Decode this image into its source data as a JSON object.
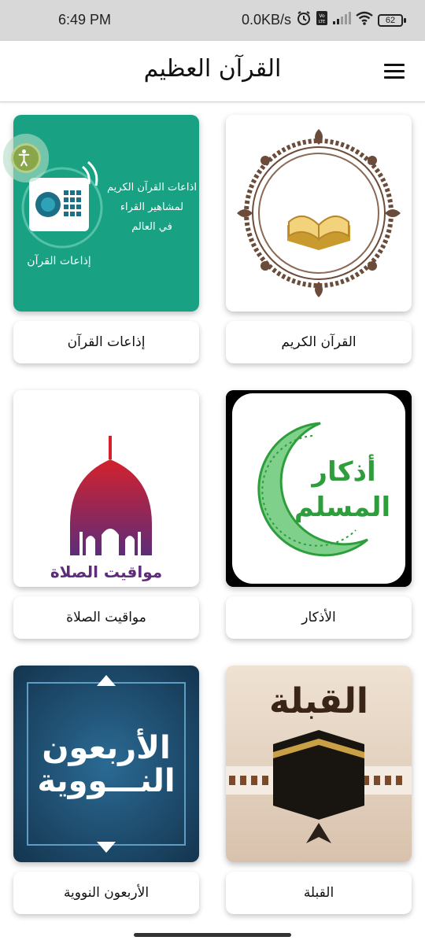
{
  "status_bar": {
    "time": "6:49 PM",
    "network_speed": "0.0KB/s",
    "battery": "62",
    "icons": [
      "alarm-icon",
      "volte-icon",
      "signal-icon",
      "wifi-icon",
      "battery-icon"
    ]
  },
  "app_bar": {
    "title": "القرآن العظيم",
    "menu_icon": "hamburger-menu-icon"
  },
  "grid": {
    "items": [
      {
        "label": "القرآن الكريم"
      },
      {
        "label": "إذاعات القرآن",
        "image_text_lines": [
          "اذاعات القرآن الكريم",
          "لمشاهير القراء",
          "في العالم"
        ],
        "image_caption": "إذاعات القرآن"
      },
      {
        "label": "الأذكار",
        "image_text_lines": [
          "أذكار",
          "المسلم"
        ]
      },
      {
        "label": "مواقيت الصلاة",
        "image_caption": "مواقيت الصلاة"
      },
      {
        "label": "القبلة",
        "image_caption": "القبلة"
      },
      {
        "label": "الأربعون النووية",
        "image_text_lines": [
          "الأربعون",
          "النـــووية"
        ]
      }
    ]
  },
  "colors": {
    "radio_bg": "#18a283",
    "azkar_green": "#2e9e3d",
    "mosque_red": "#c8202e",
    "mosque_purple": "#6c2d7a",
    "nawawi_bg": "#1c4a6e"
  }
}
